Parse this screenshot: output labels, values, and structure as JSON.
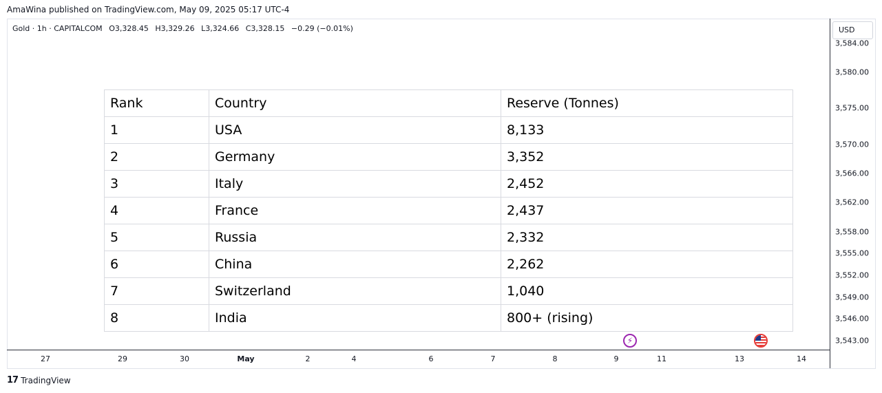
{
  "header": {
    "publish_line": "AmaWina published on TradingView.com, May 09, 2025 05:17 UTC-4"
  },
  "legend": {
    "symbol": "Gold · 1h · CAPITALCOM",
    "open": "O3,328.45",
    "high": "H3,329.26",
    "low": "L3,324.66",
    "close": "C3,328.15",
    "change": "−0.29 (−0.01%)"
  },
  "price_axis": {
    "currency": "USD",
    "ticks": [
      "3,584.00",
      "3,580.00",
      "3,575.00",
      "3,570.00",
      "3,566.00",
      "3,562.00",
      "3,558.00",
      "3,555.00",
      "3,552.00",
      "3,549.00",
      "3,546.00",
      "3,543.00"
    ]
  },
  "time_axis": {
    "ticks": [
      "27",
      "29",
      "30",
      "May",
      "2",
      "4",
      "6",
      "7",
      "8",
      "9",
      "11",
      "13",
      "14"
    ]
  },
  "table": {
    "headers": [
      "Rank",
      "Country",
      "Reserve (Tonnes)"
    ],
    "rows": [
      [
        "1",
        "USA",
        "8,133"
      ],
      [
        "2",
        "Germany",
        "3,352"
      ],
      [
        "3",
        "Italy",
        "2,452"
      ],
      [
        "4",
        "France",
        "2,437"
      ],
      [
        "5",
        "Russia",
        "2,332"
      ],
      [
        "6",
        "China",
        "2,262"
      ],
      [
        "7",
        "Switzerland",
        "1,040"
      ],
      [
        "8",
        "India",
        "800+ (rising)"
      ]
    ]
  },
  "events": {
    "bolt_icon": "lightning-icon",
    "flag_icon": "us-flag-icon"
  },
  "footer": {
    "brand": "TradingView",
    "logo": "17"
  },
  "colors": {
    "axis_line": "#2a2e39",
    "bolt": "#9c27b0",
    "flag": "#e53935"
  }
}
